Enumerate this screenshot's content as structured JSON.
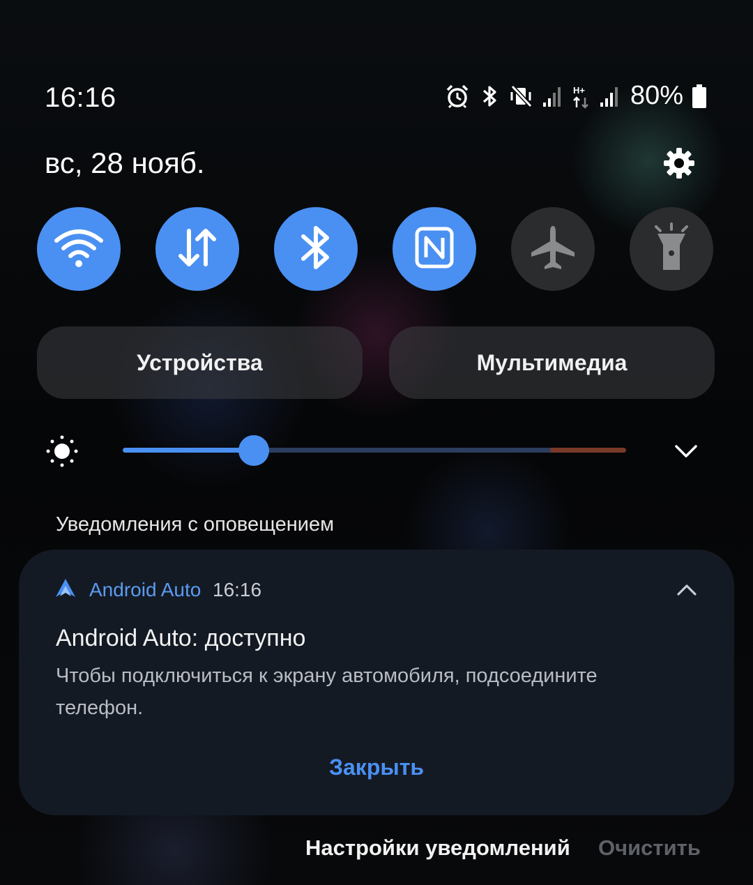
{
  "status_bar": {
    "time": "16:16",
    "battery_percent": "80%",
    "icons": [
      "alarm-icon",
      "bluetooth-icon",
      "vibrate-icon",
      "signal-icon",
      "data-hplus-icon",
      "signal-icon",
      "battery-icon"
    ],
    "network_type": "H+"
  },
  "header": {
    "date": "вс, 28 нояб."
  },
  "quick_toggles": [
    {
      "name": "wifi",
      "icon": "wifi-icon",
      "active": true
    },
    {
      "name": "mobile-data",
      "icon": "data-arrows-icon",
      "active": true
    },
    {
      "name": "bluetooth",
      "icon": "bluetooth-icon",
      "active": true
    },
    {
      "name": "nfc",
      "icon": "nfc-icon",
      "active": true
    },
    {
      "name": "airplane",
      "icon": "airplane-icon",
      "active": false
    },
    {
      "name": "flashlight",
      "icon": "flashlight-icon",
      "active": false
    }
  ],
  "pills": {
    "devices": "Устройства",
    "media": "Мультимедиа"
  },
  "brightness": {
    "level": 0.26
  },
  "section": {
    "label": "Уведомления с оповещением"
  },
  "notification": {
    "app_name": "Android Auto",
    "time": "16:16",
    "title": "Android Auto: доступно",
    "body": "Чтобы подключиться к экрану автомобиля, подсоедините телефон.",
    "action": "Закрыть"
  },
  "footer": {
    "settings": "Настройки уведомлений",
    "clear": "Очистить"
  },
  "colors": {
    "accent": "#4a90f2",
    "toggle_off": "#2b2c2e",
    "card": "#141a24"
  }
}
